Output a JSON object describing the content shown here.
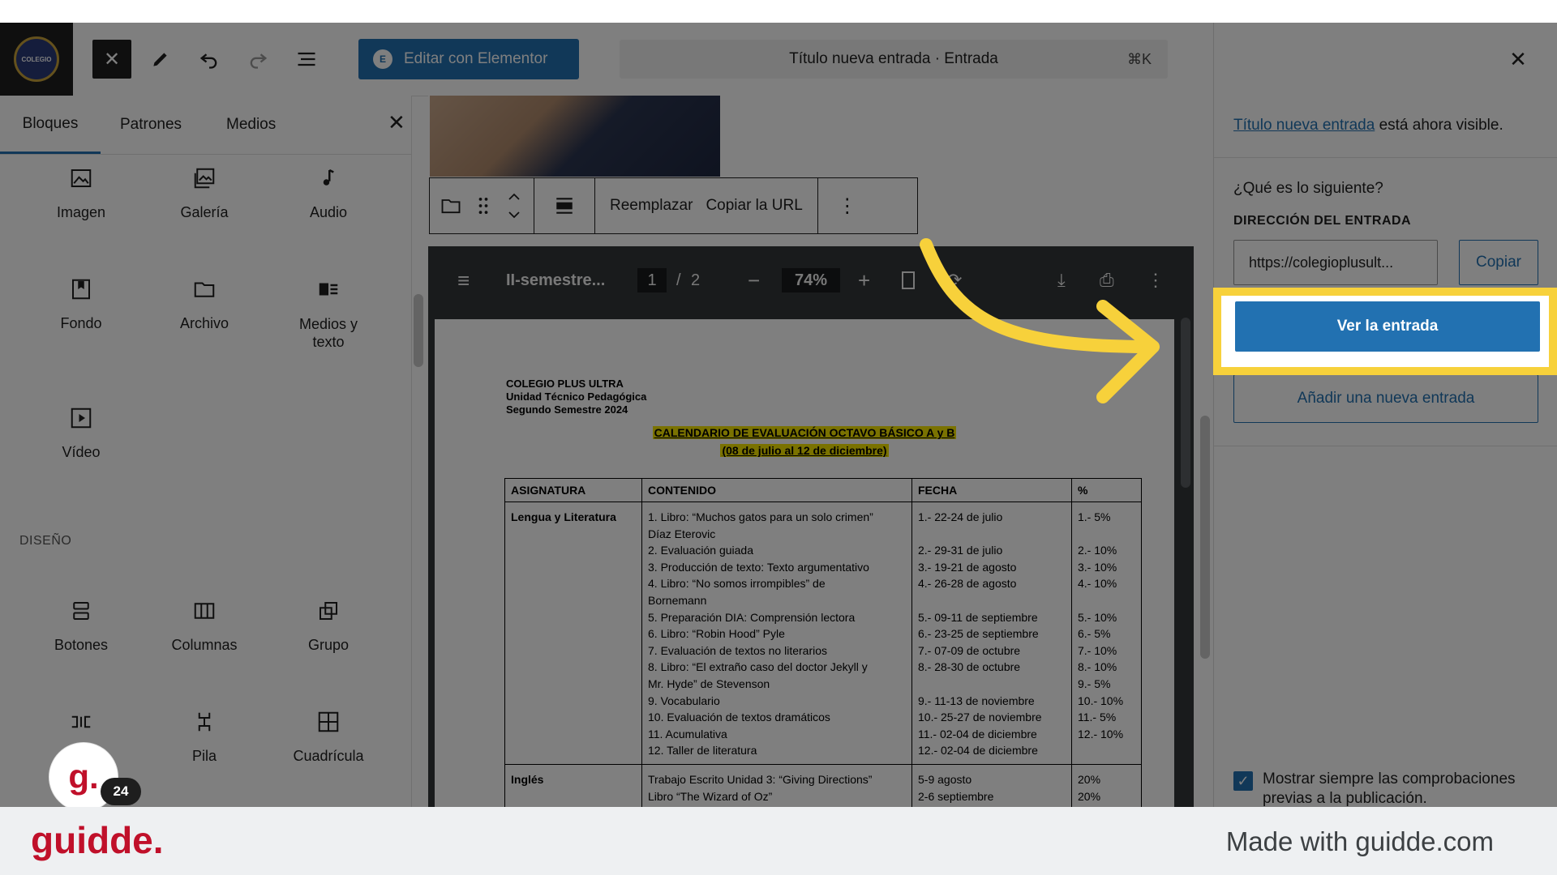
{
  "topbar": {
    "site_logo_text": "COLEGIO",
    "edit_elementor_label": "Editar con Elementor",
    "command_title": "Título nueva entrada · Entrada",
    "command_shortcut": "⌘K"
  },
  "inserter": {
    "tabs": [
      "Bloques",
      "Patrones",
      "Medios"
    ],
    "blocks": [
      {
        "label": "Imagen"
      },
      {
        "label": "Galería"
      },
      {
        "label": "Audio"
      },
      {
        "label": "Fondo"
      },
      {
        "label": "Archivo"
      },
      {
        "label": "Medios y texto"
      },
      {
        "label": "Vídeo"
      }
    ],
    "design_section": "DISEÑO",
    "design_blocks": [
      {
        "label": "Botones"
      },
      {
        "label": "Columnas"
      },
      {
        "label": "Grupo"
      },
      {
        "label": ""
      },
      {
        "label": "Pila"
      },
      {
        "label": "Cuadrícula"
      }
    ]
  },
  "block_toolbar": {
    "replace": "Reemplazar",
    "copy_url": "Copiar la URL"
  },
  "pdf": {
    "filename": "II-semestre...",
    "page_current": "1",
    "page_sep": "/",
    "page_total": "2",
    "zoom": "74%",
    "doc": {
      "school": "COLEGIO PLUS ULTRA",
      "unit": "Unidad Técnico Pedagógica",
      "semester": "Segundo Semestre 2024",
      "title": "CALENDARIO DE EVALUACIÓN OCTAVO BÁSICO A y B",
      "subtitle": "(08 de julio al 12 de diciembre)",
      "headers": [
        "ASIGNATURA",
        "CONTENIDO",
        "FECHA",
        "%"
      ],
      "row1": {
        "subject": "Lengua y Literatura",
        "content": [
          "1. Libro: “Muchos gatos para un solo crimen”",
          "Díaz Eterovic",
          "2. Evaluación guiada",
          "3. Producción de texto: Texto argumentativo",
          "4. Libro: “No somos irrompibles” de",
          "Bornemann",
          "5. Preparación DIA: Comprensión lectora",
          "6. Libro: “Robin Hood” Pyle",
          "7. Evaluación de textos no literarios",
          "8. Libro: “El extraño caso del doctor Jekyll y",
          "Mr. Hyde” de Stevenson",
          "9. Vocabulario",
          "10. Evaluación de textos dramáticos",
          "11. Acumulativa",
          "12. Taller de literatura"
        ],
        "dates": [
          "1.- 22-24 de julio",
          "",
          "2.- 29-31 de julio",
          "3.- 19-21 de agosto",
          "4.- 26-28 de agosto",
          "",
          "5.- 09-11 de septiembre",
          "6.- 23-25 de septiembre",
          "7.- 07-09 de octubre",
          "8.- 28-30 de octubre",
          "",
          "9.- 11-13 de noviembre",
          "10.- 25-27 de noviembre",
          "11.- 02-04 de diciembre",
          "12.- 02-04 de diciembre"
        ],
        "percent": [
          "1.- 5%",
          "",
          "2.- 10%",
          "3.- 10%",
          "4.- 10%",
          "",
          "5.- 10%",
          "6.- 5%",
          "7.- 10%",
          "8.- 10%",
          "9.- 5%",
          "10.- 10%",
          "11.- 5%",
          "12.- 10%",
          ""
        ]
      },
      "row2": {
        "subject": "Inglés",
        "content": [
          "Trabajo Escrito Unidad 3: “Giving Directions”",
          "Libro “The Wizard of Oz”"
        ],
        "dates": [
          "5-9 agosto",
          "2-6 septiembre"
        ],
        "percent": [
          "20%",
          "20%"
        ]
      }
    }
  },
  "post_panel": {
    "visible_link": "Título nueva entrada",
    "visible_suffix": " está ahora visible.",
    "next_question": "¿Qué es lo siguiente?",
    "address_label": "DIRECCIÓN DEL ENTRADA",
    "url_value": "https://colegioplusult...",
    "copy_label": "Copiar",
    "view_label": "Ver la entrada",
    "new_label": "Añadir una nueva entrada",
    "checkbox_label": "Mostrar siempre las comprobaciones previas a la publicación."
  },
  "guidde": {
    "avatar_letter": "g.",
    "badge_count": "24",
    "brand": "guidde.",
    "made_with": "Made with guidde.com"
  },
  "colors": {
    "accent": "#2271b1",
    "highlight": "#f7d13b",
    "brand_red": "#c0102a"
  }
}
